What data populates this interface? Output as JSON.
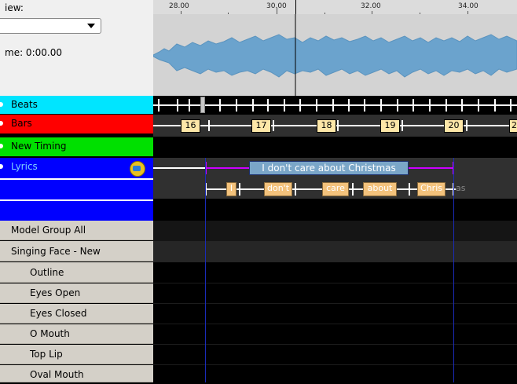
{
  "view": {
    "label": "iew:",
    "select_value": ""
  },
  "time": {
    "label": "me: 0:00.00"
  },
  "ruler": {
    "ticks": [
      "28.00",
      "30.00",
      "32.00",
      "34.00"
    ]
  },
  "timing_tracks": [
    {
      "label": "Beats",
      "color": "#00e5ff"
    },
    {
      "label": "Bars",
      "color": "#ff0000"
    },
    {
      "label": "New Timing",
      "color": "#00e000"
    },
    {
      "label": "Lyrics",
      "color": "#0000ff"
    }
  ],
  "models": [
    {
      "label": "Model Group All",
      "indent": false
    },
    {
      "label": "Singing Face - New",
      "indent": false
    },
    {
      "label": "Outline",
      "indent": true
    },
    {
      "label": "Eyes Open",
      "indent": true
    },
    {
      "label": "Eyes Closed",
      "indent": true
    },
    {
      "label": "O Mouth",
      "indent": true
    },
    {
      "label": "Top Lip",
      "indent": true
    },
    {
      "label": "Oval Mouth",
      "indent": true
    }
  ],
  "bars": [
    "16",
    "17",
    "18",
    "19",
    "20",
    "2"
  ],
  "lyric_phrase": "I don't care about Christmas",
  "lyric_words": [
    "I",
    "don't",
    "care",
    "about",
    "Chris"
  ],
  "lyric_overflow": "as",
  "colors": {
    "accent_purple": "#cc00ff",
    "phrase_bg": "#7aa6c8",
    "word_bg": "#f3c27c",
    "bar_label_bg": "#fde7a8"
  }
}
